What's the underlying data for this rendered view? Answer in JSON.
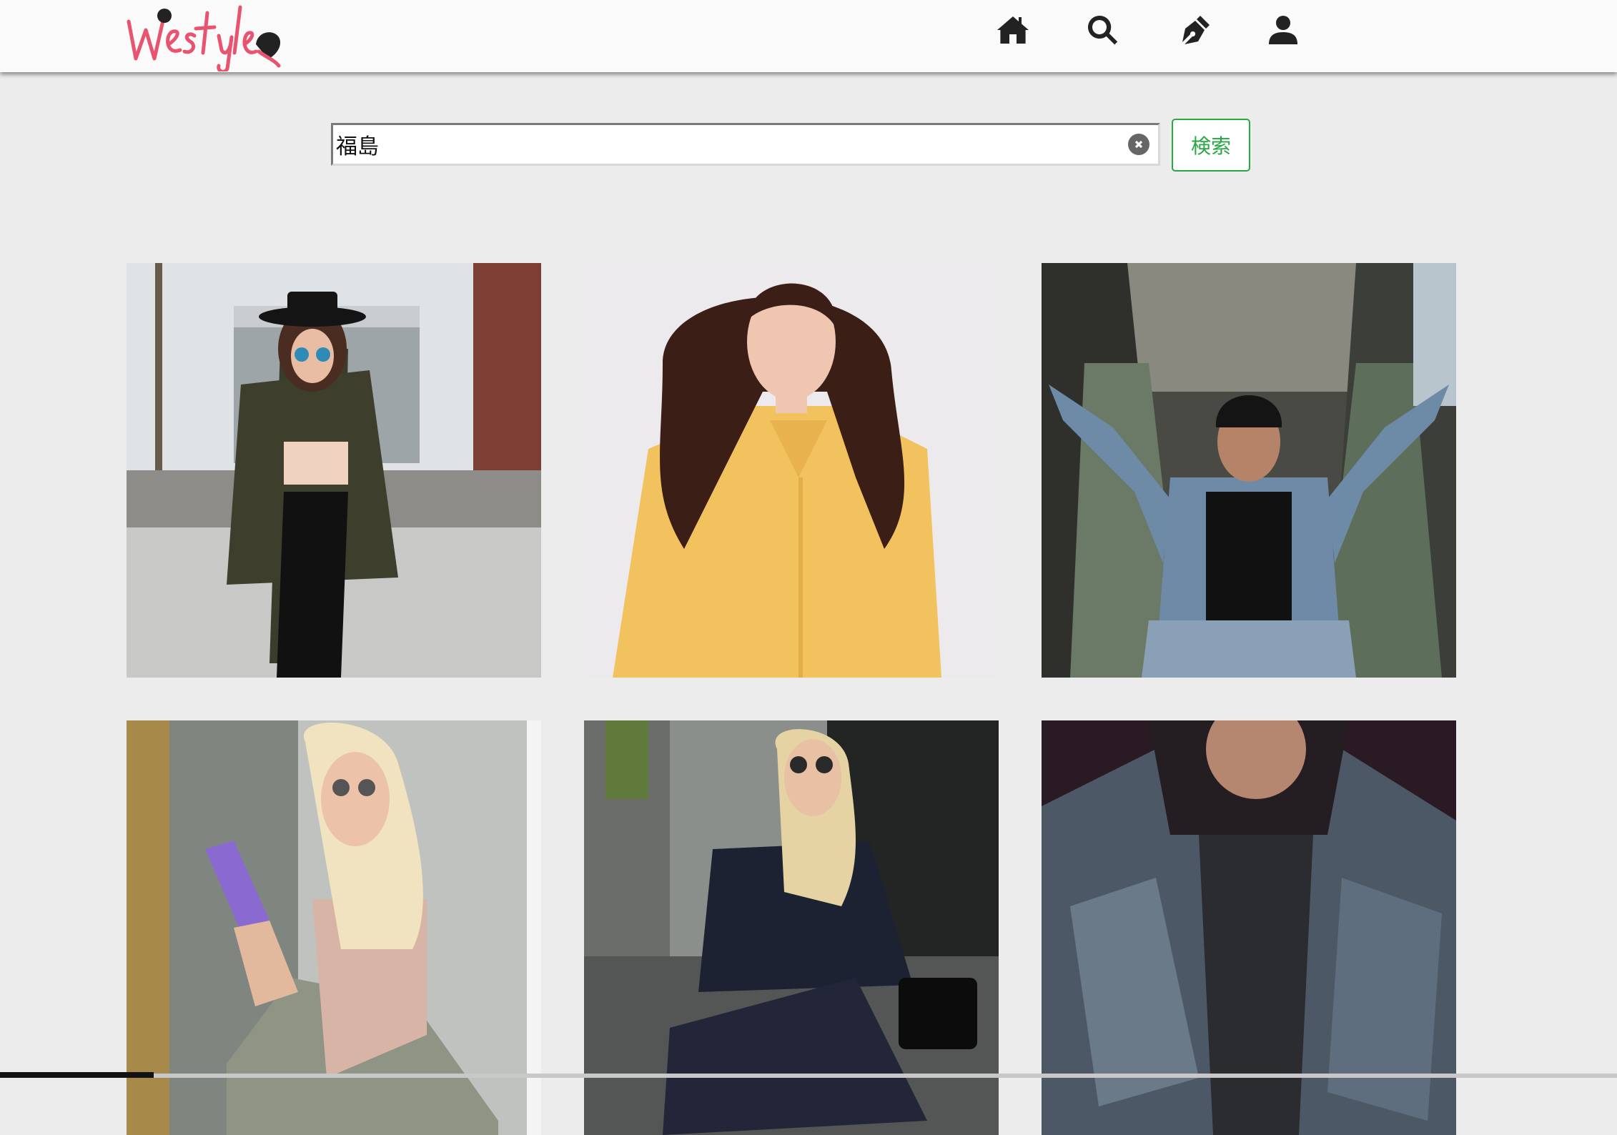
{
  "header": {
    "logo_text": "Westyles",
    "nav": [
      {
        "icon": "home-icon"
      },
      {
        "icon": "search-icon"
      },
      {
        "icon": "pen-icon"
      },
      {
        "icon": "user-icon"
      }
    ]
  },
  "search": {
    "value": "福島",
    "placeholder": "",
    "button_label": "検索"
  },
  "colors": {
    "accent": "#28a745",
    "logo": "#e8536f",
    "background": "#ececec"
  },
  "gallery": {
    "items": [
      {
        "subject": "woman-in-hat-olive-coat"
      },
      {
        "subject": "woman-yellow-shirt"
      },
      {
        "subject": "man-denim-jacket-escalator"
      },
      {
        "subject": "woman-blonde-phone"
      },
      {
        "subject": "woman-navy-outfit-sitting"
      },
      {
        "subject": "man-denim-jacket-hood"
      }
    ]
  }
}
